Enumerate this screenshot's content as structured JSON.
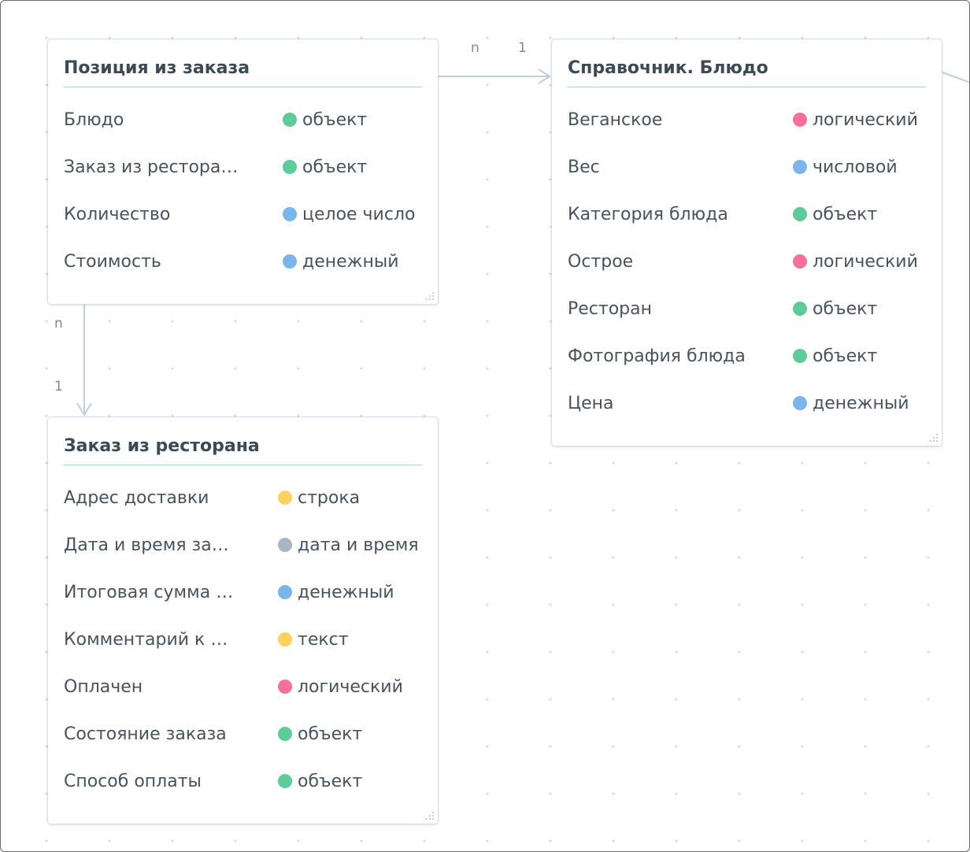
{
  "colors": {
    "object": "#5ecb9a",
    "boolean": "#f76f9a",
    "number": "#7cb4ec",
    "string": "#fcd25e",
    "datetime": "#a8b6c6"
  },
  "relations": {
    "r1_from": "n",
    "r1_to": "1",
    "r2_from": "n",
    "r2_to": "1"
  },
  "entities": [
    {
      "title": "Позиция из заказа",
      "fields": [
        {
          "name": "Блюдо",
          "type": "объект",
          "color": "#5ecb9a"
        },
        {
          "name": "Заказ из ресторa…",
          "type": "объект",
          "color": "#5ecb9a"
        },
        {
          "name": "Количество",
          "type": "целое число",
          "color": "#7cb4ec"
        },
        {
          "name": "Стоимость",
          "type": "денежный",
          "color": "#7cb4ec"
        }
      ]
    },
    {
      "title": "Справочник. Блюдо",
      "fields": [
        {
          "name": "Веганское",
          "type": "логический",
          "color": "#f76f9a"
        },
        {
          "name": "Вес",
          "type": "числовой",
          "color": "#7cb4ec"
        },
        {
          "name": "Категория блюда",
          "type": "объект",
          "color": "#5ecb9a"
        },
        {
          "name": "Острое",
          "type": "логический",
          "color": "#f76f9a"
        },
        {
          "name": "Ресторан",
          "type": "объект",
          "color": "#5ecb9a"
        },
        {
          "name": "Фотография блюда",
          "type": "объект",
          "color": "#5ecb9a"
        },
        {
          "name": "Цена",
          "type": "денежный",
          "color": "#7cb4ec"
        }
      ]
    },
    {
      "title": "Заказ из ресторана",
      "fields": [
        {
          "name": "Адрес доставки",
          "type": "строка",
          "color": "#fcd25e"
        },
        {
          "name": "Дата и время за…",
          "type": "дата и время",
          "color": "#a8b6c6"
        },
        {
          "name": "Итоговая сумма …",
          "type": "денежный",
          "color": "#7cb4ec"
        },
        {
          "name": "Комментарий к …",
          "type": "текст",
          "color": "#fcd25e"
        },
        {
          "name": "Оплачен",
          "type": "логический",
          "color": "#f76f9a"
        },
        {
          "name": "Состояние заказа",
          "type": "объект",
          "color": "#5ecb9a"
        },
        {
          "name": "Способ оплаты",
          "type": "объект",
          "color": "#5ecb9a"
        }
      ]
    }
  ]
}
